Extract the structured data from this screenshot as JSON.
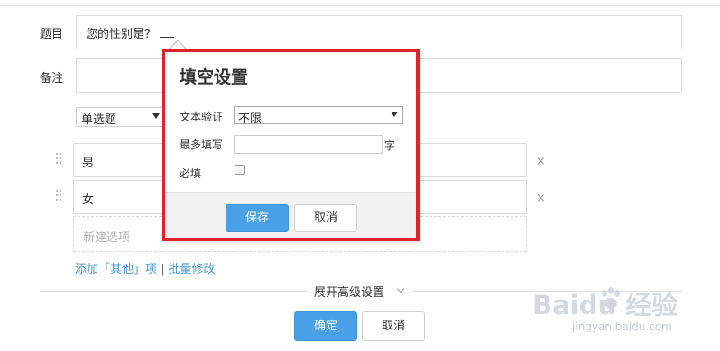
{
  "form": {
    "title_label": "题目",
    "title_value": "您的性别是？",
    "note_label": "备注",
    "note_value": "",
    "question_type": "单选题",
    "options": [
      {
        "text": "男"
      },
      {
        "text": "女"
      }
    ],
    "new_option_placeholder": "新建选项",
    "add_other_link": "添加「其他」项",
    "link_separator": "|",
    "bulk_edit_link": "批量修改",
    "advanced_settings": "展开高级设置",
    "confirm_button": "确定",
    "cancel_button": "取消",
    "remove_symbol": "×"
  },
  "popup": {
    "title": "填空设置",
    "validation_label": "文本验证",
    "validation_value": "不限",
    "max_length_label": "最多填写",
    "max_length_value": "",
    "max_length_unit": "字",
    "required_label": "必填",
    "required_checked": false,
    "save_button": "保存",
    "cancel_button": "取消"
  },
  "colors": {
    "primary": "#4aa0e6",
    "highlight": "#e0232b",
    "link": "#4a9ad8"
  },
  "watermark": {
    "brand": "Baidu 经验",
    "url": "jingyan.baidu.com"
  }
}
